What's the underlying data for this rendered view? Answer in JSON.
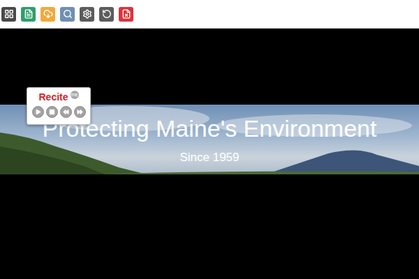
{
  "toolbar": {
    "buttons": [
      {
        "color": "#4a4a4a"
      },
      {
        "color": "#2f9e6e"
      },
      {
        "color": "#f2a93b"
      },
      {
        "color": "#6f8fb3"
      },
      {
        "color": "#5c5c5c"
      },
      {
        "color": "#5c5c5c"
      },
      {
        "color": "#e0323a"
      }
    ]
  },
  "banner": {
    "title": "Protecting Maine's Environment",
    "subtitle": "Since 1959"
  },
  "recite": {
    "logo": "Recite",
    "badge": "me"
  }
}
